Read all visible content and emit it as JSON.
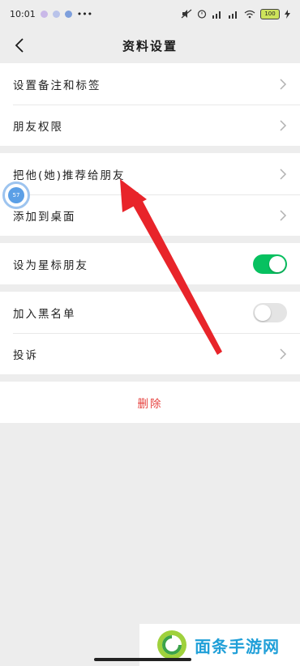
{
  "status_bar": {
    "time": "10:01",
    "more": "•••",
    "battery": "100"
  },
  "header": {
    "title": "资料设置"
  },
  "groups": {
    "g1": [
      {
        "label": "设置备注和标签"
      },
      {
        "label": "朋友权限"
      }
    ],
    "g2": [
      {
        "label": "把他(她)推荐给朋友"
      },
      {
        "label": "添加到桌面"
      }
    ],
    "g3": [
      {
        "label": "设为星标朋友",
        "toggle": "on"
      }
    ],
    "g4": [
      {
        "label": "加入黑名单",
        "toggle": "off"
      },
      {
        "label": "投诉"
      }
    ]
  },
  "delete_label": "删除",
  "float_bubble_text": "57",
  "watermark": {
    "text": "面条手游网"
  },
  "colors": {
    "toggle_on": "#07c160",
    "delete": "#e64340",
    "arrow": "#e8242a",
    "background": "#ededed"
  }
}
